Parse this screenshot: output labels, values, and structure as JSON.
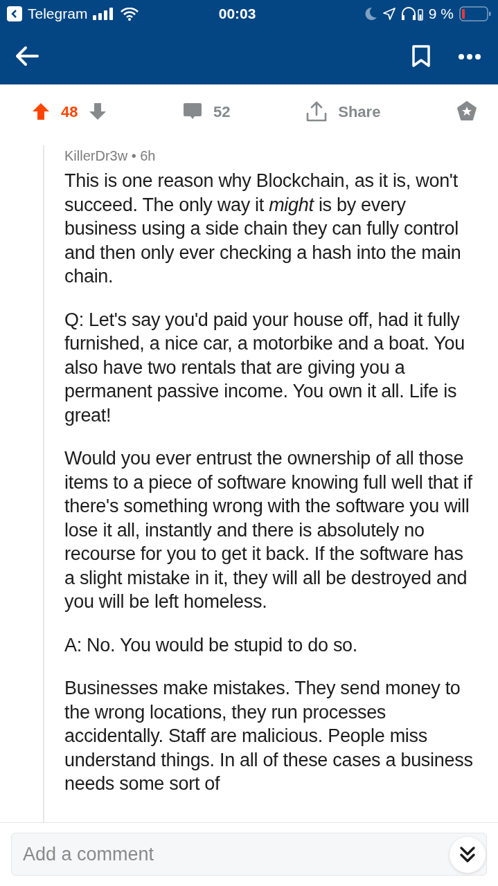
{
  "status_bar": {
    "back_app": "Telegram",
    "time": "00:03",
    "battery": "9 %",
    "do_not_disturb": true
  },
  "post_actions": {
    "score": "48",
    "upvoted": true,
    "comments": "52",
    "share": "Share"
  },
  "comment": {
    "author": "KillerDr3w",
    "separator": "•",
    "age": "6h",
    "paragraphs": [
      "This is one reason why Blockchain, as it is, won't succeed.  The only way it *might* is by every business using a side chain they can fully control and then only ever checking a hash into the main chain.",
      "Q:  Let's say you'd paid your house off, had it fully furnished, a nice car, a motorbike and a boat.  You also have two rentals that are giving you a permanent passive income.  You own it all.  Life is great!",
      "Would you ever entrust the ownership of all those items to a piece of software knowing full well that if there's something wrong with the software you will lose it all, instantly and there is absolutely no recourse for you to get it back.  If the software has a slight mistake in it, they will all be destroyed and you will be left homeless.",
      "A: No.  You would be stupid to do so.",
      "Businesses make mistakes.  They send money to the wrong locations, they run processes accidentally.  Staff are malicious.  People miss understand things.  In all of these cases a business needs some sort of"
    ]
  },
  "composer": {
    "placeholder": "Add a comment"
  }
}
